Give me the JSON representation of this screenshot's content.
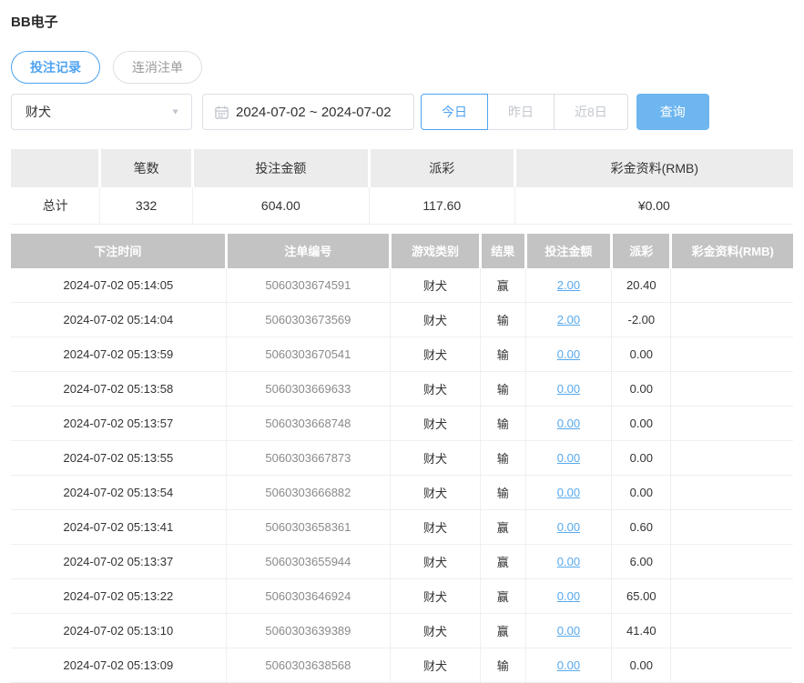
{
  "page": {
    "title": "BB电子"
  },
  "tabs": [
    {
      "label": "投注记录",
      "active": true
    },
    {
      "label": "连消注单",
      "active": false
    }
  ],
  "filters": {
    "game_select": {
      "value": "财犬"
    },
    "date_range": "2024-07-02 ~ 2024-07-02",
    "quick_buttons": [
      {
        "label": "今日",
        "active": true
      },
      {
        "label": "昨日",
        "active": false
      },
      {
        "label": "近8日",
        "active": false
      }
    ],
    "search_label": "查询"
  },
  "icons": {
    "calendar": "calendar-icon",
    "caret": "caret-down-icon",
    "caret_glyph": "▼"
  },
  "colors": {
    "accent_blue": "#4ea3f1",
    "search_button_bg": "#6db6f0",
    "link_blue": "#57a9ee",
    "negative_red": "#f25b5b",
    "records_header_bg": "#c3c3c3",
    "summary_header_bg": "#ececec"
  },
  "summary": {
    "headers": [
      "",
      "笔数",
      "投注金额",
      "派彩",
      "彩金资料(RMB)"
    ],
    "row": {
      "label": "总计",
      "count": "332",
      "bet_amount": "604.00",
      "payout": "117.60",
      "bonus": "¥0.00"
    }
  },
  "records": {
    "headers": [
      "下注时间",
      "注单编号",
      "游戏类别",
      "结果",
      "投注金额",
      "派彩",
      "彩金资料(RMB)"
    ],
    "rows": [
      {
        "time": "2024-07-02 05:14:05",
        "order_no": "5060303674591",
        "game": "财犬",
        "result": "赢",
        "bet": "2.00",
        "payout": "20.40",
        "bonus": ""
      },
      {
        "time": "2024-07-02 05:14:04",
        "order_no": "5060303673569",
        "game": "财犬",
        "result": "输",
        "bet": "2.00",
        "payout": "-2.00",
        "bonus": ""
      },
      {
        "time": "2024-07-02 05:13:59",
        "order_no": "5060303670541",
        "game": "财犬",
        "result": "输",
        "bet": "0.00",
        "payout": "0.00",
        "bonus": ""
      },
      {
        "time": "2024-07-02 05:13:58",
        "order_no": "5060303669633",
        "game": "财犬",
        "result": "输",
        "bet": "0.00",
        "payout": "0.00",
        "bonus": ""
      },
      {
        "time": "2024-07-02 05:13:57",
        "order_no": "5060303668748",
        "game": "财犬",
        "result": "输",
        "bet": "0.00",
        "payout": "0.00",
        "bonus": ""
      },
      {
        "time": "2024-07-02 05:13:55",
        "order_no": "5060303667873",
        "game": "财犬",
        "result": "输",
        "bet": "0.00",
        "payout": "0.00",
        "bonus": ""
      },
      {
        "time": "2024-07-02 05:13:54",
        "order_no": "5060303666882",
        "game": "财犬",
        "result": "输",
        "bet": "0.00",
        "payout": "0.00",
        "bonus": ""
      },
      {
        "time": "2024-07-02 05:13:41",
        "order_no": "5060303658361",
        "game": "财犬",
        "result": "赢",
        "bet": "0.00",
        "payout": "0.60",
        "bonus": ""
      },
      {
        "time": "2024-07-02 05:13:37",
        "order_no": "5060303655944",
        "game": "财犬",
        "result": "赢",
        "bet": "0.00",
        "payout": "6.00",
        "bonus": ""
      },
      {
        "time": "2024-07-02 05:13:22",
        "order_no": "5060303646924",
        "game": "财犬",
        "result": "赢",
        "bet": "0.00",
        "payout": "65.00",
        "bonus": ""
      },
      {
        "time": "2024-07-02 05:13:10",
        "order_no": "5060303639389",
        "game": "财犬",
        "result": "赢",
        "bet": "0.00",
        "payout": "41.40",
        "bonus": ""
      },
      {
        "time": "2024-07-02 05:13:09",
        "order_no": "5060303638568",
        "game": "财犬",
        "result": "输",
        "bet": "0.00",
        "payout": "0.00",
        "bonus": ""
      }
    ]
  }
}
